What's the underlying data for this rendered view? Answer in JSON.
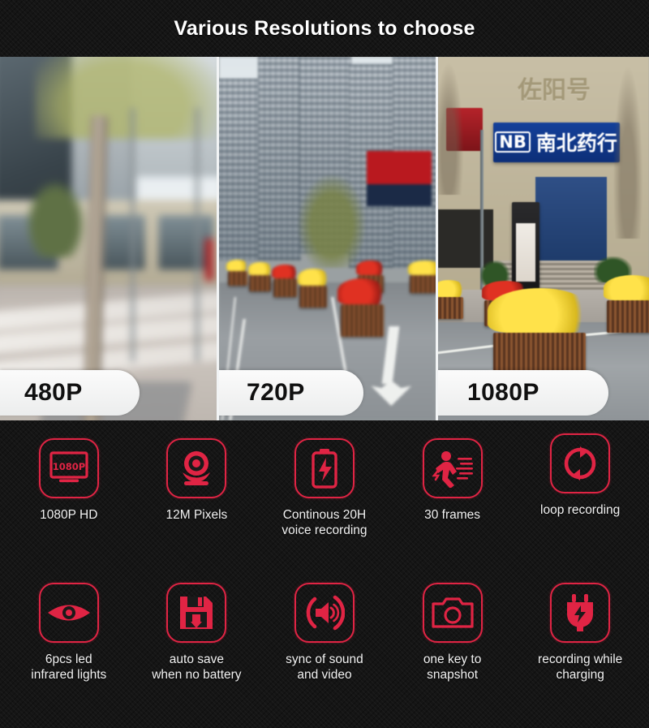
{
  "header": {
    "title": "Various Resolutions to choose"
  },
  "comparison": {
    "panels": [
      {
        "label": "480P",
        "scene": "blurred city street with tree trunk and crosswalk",
        "quality": "lowest"
      },
      {
        "label": "720P",
        "scene": "avenue with flower planters and road arrow",
        "quality": "medium"
      },
      {
        "label": "1080P",
        "scene": "storefront with blue shop sign and yellow flower planters",
        "quality": "highest"
      }
    ],
    "sign_text": {
      "banner": "南北药行",
      "banner_mark": "NB",
      "building_top": "佐阳号"
    }
  },
  "features": {
    "rows": [
      [
        {
          "icon": "monitor-1080p-icon",
          "icon_text": "1080P",
          "label": "1080P HD"
        },
        {
          "icon": "webcam-icon",
          "label": "12M Pixels"
        },
        {
          "icon": "battery-bolt-icon",
          "label": "Continous 20H\nvoice recording"
        },
        {
          "icon": "running-person-icon",
          "label": "30 frames"
        },
        {
          "icon": "loop-arrows-icon",
          "label": "loop recording"
        }
      ],
      [
        {
          "icon": "eye-icon",
          "label": "6pcs led\ninfrared lights"
        },
        {
          "icon": "floppy-save-icon",
          "label": "auto save\nwhen no battery"
        },
        {
          "icon": "speaker-sound-icon",
          "label": "sync of sound\nand video"
        },
        {
          "icon": "camera-icon",
          "label": "one key to\nsnapshot"
        },
        {
          "icon": "power-plug-bolt-icon",
          "label": "recording while\ncharging"
        }
      ]
    ]
  },
  "colors": {
    "accent_red": "#e02444",
    "background_dark": "#151515",
    "text_light": "#f2f2f2",
    "pill_background": "#fbfbfb",
    "sign_blue": "#14409a"
  }
}
